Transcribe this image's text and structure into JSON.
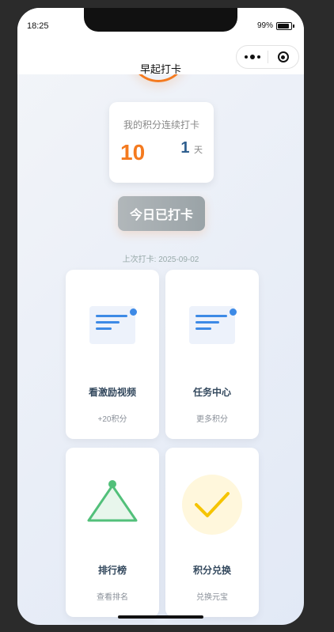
{
  "status_bar": {
    "time": "18:25",
    "battery_percent": "99%"
  },
  "nav": {
    "title": "早起打卡"
  },
  "points_card": {
    "label": "我的积分连续打卡",
    "points": "10",
    "streak_days": "1",
    "days_unit": "天"
  },
  "checkin_button": {
    "label": "今日已打卡"
  },
  "last_checkin": "上次打卡: 2025-09-02",
  "cards": [
    {
      "title": "看激励视频",
      "subtitle": "+20积分",
      "icon": "document-icon"
    },
    {
      "title": "任务中心",
      "subtitle": "更多积分",
      "icon": "document-icon"
    },
    {
      "title": "排行榜",
      "subtitle": "查看排名",
      "icon": "triangle-icon"
    },
    {
      "title": "积分兑换",
      "subtitle": "兑换元宝",
      "icon": "checkmark-icon"
    }
  ],
  "colors": {
    "accent_orange": "#f47a1f",
    "primary_blue": "#3d8ae6",
    "green": "#52c07a",
    "yellow": "#f5c400"
  }
}
